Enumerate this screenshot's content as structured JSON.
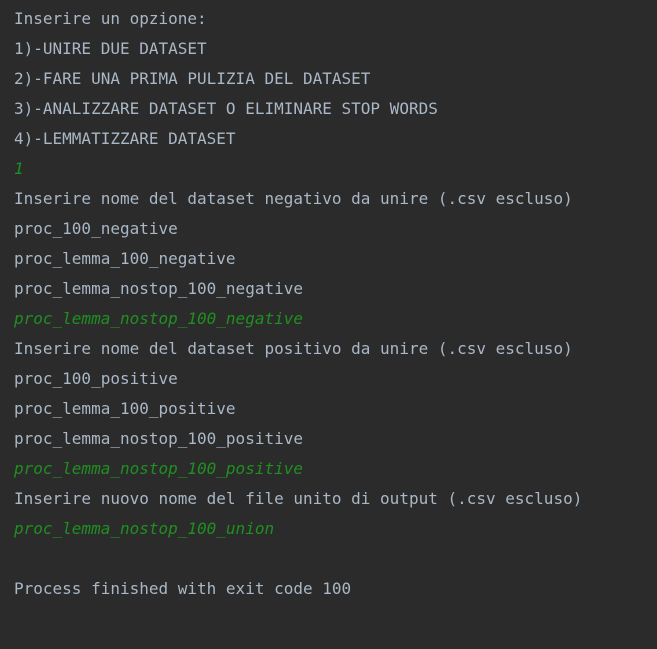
{
  "console": {
    "colors": {
      "background": "#2b2b2b",
      "output_text": "#a9b7c6",
      "user_input_text": "#1f8f20"
    },
    "lines": [
      {
        "text": "Inserire un opzione:",
        "kind": "output"
      },
      {
        "text": "1)-UNIRE DUE DATASET",
        "kind": "output"
      },
      {
        "text": "2)-FARE UNA PRIMA PULIZIA DEL DATASET",
        "kind": "output"
      },
      {
        "text": "3)-ANALIZZARE DATASET O ELIMINARE STOP WORDS",
        "kind": "output"
      },
      {
        "text": "4)-LEMMATIZZARE DATASET",
        "kind": "output"
      },
      {
        "text": "1",
        "kind": "input"
      },
      {
        "text": "Inserire nome del dataset negativo da unire (.csv escluso)",
        "kind": "output"
      },
      {
        "text": "proc_100_negative",
        "kind": "output"
      },
      {
        "text": "proc_lemma_100_negative",
        "kind": "output"
      },
      {
        "text": "proc_lemma_nostop_100_negative",
        "kind": "output"
      },
      {
        "text": "proc_lemma_nostop_100_negative",
        "kind": "input"
      },
      {
        "text": "Inserire nome del dataset positivo da unire (.csv escluso)",
        "kind": "output"
      },
      {
        "text": "proc_100_positive",
        "kind": "output"
      },
      {
        "text": "proc_lemma_100_positive",
        "kind": "output"
      },
      {
        "text": "proc_lemma_nostop_100_positive",
        "kind": "output"
      },
      {
        "text": "proc_lemma_nostop_100_positive",
        "kind": "input"
      },
      {
        "text": "Inserire nuovo nome del file unito di output (.csv escluso)",
        "kind": "output"
      },
      {
        "text": "proc_lemma_nostop_100_union",
        "kind": "input"
      },
      {
        "text": "",
        "kind": "blank"
      },
      {
        "text": "Process finished with exit code 100",
        "kind": "output"
      }
    ]
  }
}
